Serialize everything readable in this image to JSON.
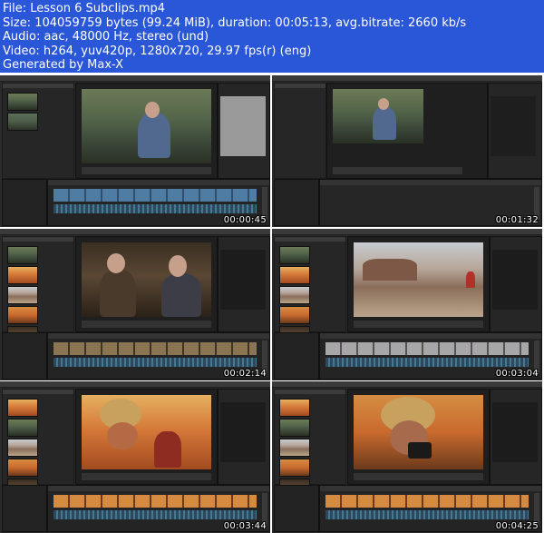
{
  "header": {
    "file_line": "File: Lesson 6 Subclips.mp4",
    "size_line": "Size: 104059759 bytes (99.24 MiB), duration: 00:05:13, avg.bitrate: 2660 kb/s",
    "audio_line": "Audio: aac, 48000 Hz, stereo (und)",
    "video_line": "Video: h264, yuv420p, 1280x720, 29.97 fps(r) (eng)",
    "generated_line": "Generated by Max-X"
  },
  "colors": {
    "header_bg": "#2a56d8",
    "header_text": "#ffffff",
    "ui_bg": "#2b2b2b",
    "timeline_video": "#4e7ca2",
    "timeline_audio": "#4a88a8"
  },
  "thumbnails": [
    {
      "timestamp": "00:00:45",
      "scene": "man-in-grass"
    },
    {
      "timestamp": "00:01:32",
      "scene": "man-in-grass"
    },
    {
      "timestamp": "00:02:14",
      "scene": "two-men-interior"
    },
    {
      "timestamp": "00:03:04",
      "scene": "desert-landscape"
    },
    {
      "timestamp": "00:03:44",
      "scene": "canyon-photographer"
    },
    {
      "timestamp": "00:04:25",
      "scene": "canyon-photographer-closeup"
    }
  ]
}
